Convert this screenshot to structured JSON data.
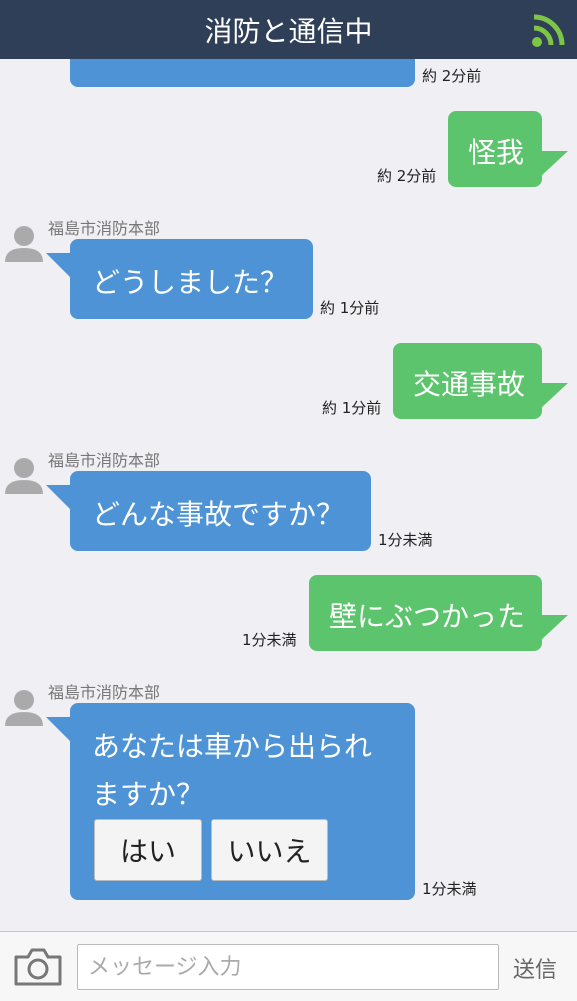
{
  "header": {
    "title": "消防と通信中"
  },
  "messages": {
    "m0": {
      "time": "約 2分前"
    },
    "m1": {
      "text": "怪我",
      "time": "約 2分前"
    },
    "m2": {
      "sender": "福島市消防本部",
      "text": "どうしました？",
      "time": "約 1分前"
    },
    "m3": {
      "text": "交通事故",
      "time": "約 1分前"
    },
    "m4": {
      "sender": "福島市消防本部",
      "text": "どんな事故ですか？",
      "time": "1分未満"
    },
    "m5": {
      "text": "壁にぶつかった",
      "time": "1分未満"
    },
    "m6": {
      "sender": "福島市消防本部",
      "line1": "あなたは車から出られ",
      "line2": "ますか？",
      "time": "1分未満",
      "options": [
        "はい",
        "いいえ"
      ]
    }
  },
  "composer": {
    "placeholder": "メッセージ入力",
    "send_label": "送信"
  },
  "colors": {
    "header": "#2f3f58",
    "received": "#4e93d6",
    "sent": "#5cc46d",
    "wifi": "#7dc544"
  },
  "icons": {
    "signal": "wifi-signal-icon",
    "avatar": "user-avatar-icon",
    "camera": "camera-icon"
  }
}
